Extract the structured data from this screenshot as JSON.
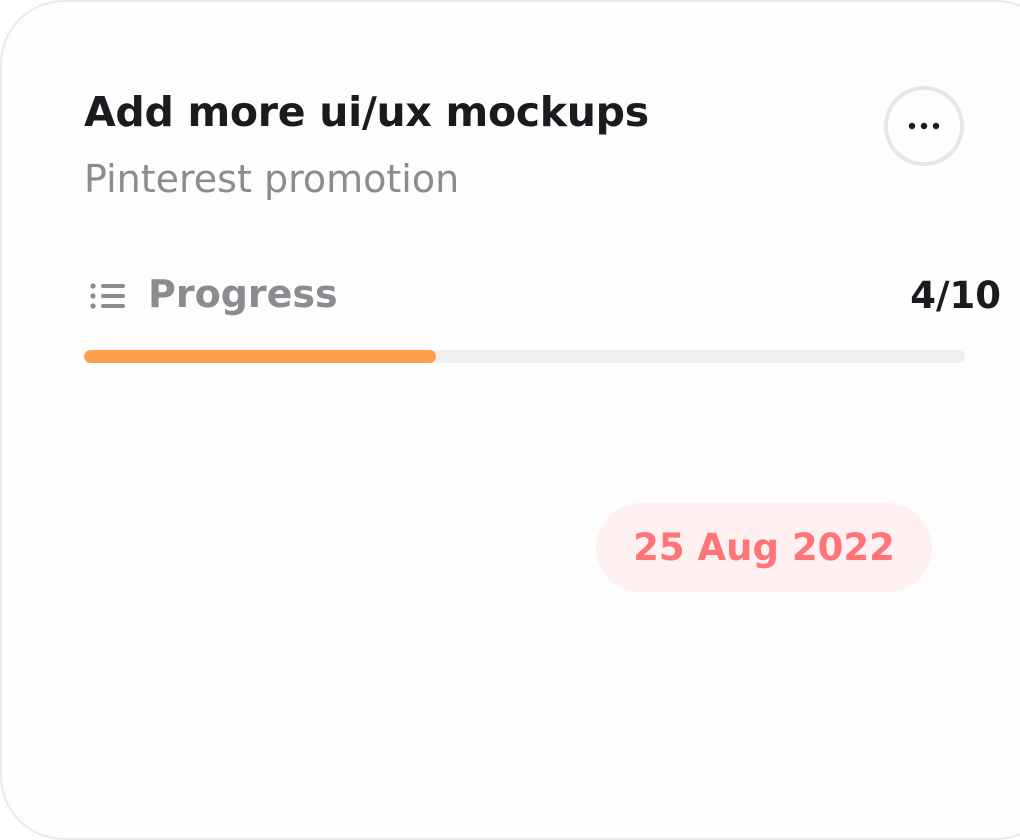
{
  "card": {
    "title": "Add more ui/ux mockups",
    "subtitle": "Pinterest promotion",
    "more_icon": "more-horizontal-icon",
    "progress": {
      "icon": "list-icon",
      "label": "Progress",
      "count": "4/10",
      "completed": 4,
      "total": 10,
      "fraction": 0.4,
      "fill_color": "#ff9f4a",
      "track_color": "#efeef1"
    },
    "due_date": "25 Aug 2022",
    "due_date_color": "#ff7476",
    "due_date_background": "#fff0f1"
  }
}
